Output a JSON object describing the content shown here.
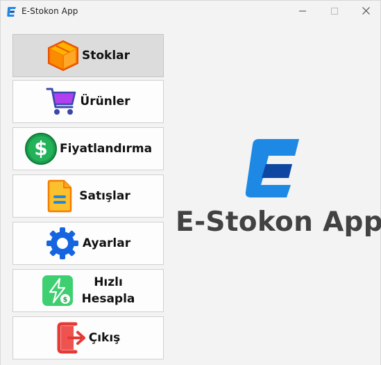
{
  "window": {
    "title": "E-Stokon App",
    "controls": {
      "minimize": "minimize",
      "maximize": "maximize",
      "close": "close"
    }
  },
  "nav": {
    "items": [
      {
        "label": "Stoklar",
        "icon": "box-icon",
        "active": true
      },
      {
        "label": "Ürünler",
        "icon": "cart-icon",
        "active": false
      },
      {
        "label": "Fiyatlandırma",
        "icon": "dollar-icon",
        "active": false
      },
      {
        "label": "Satışlar",
        "icon": "document-icon",
        "active": false
      },
      {
        "label": "Ayarlar",
        "icon": "gear-icon",
        "active": false
      },
      {
        "label_line1": "Hızlı",
        "label_line2": "Hesapla",
        "icon": "quick-calc-icon",
        "active": false
      },
      {
        "label": "Çıkış",
        "icon": "exit-icon",
        "active": false
      }
    ]
  },
  "brand": {
    "name": "E-Stokon App",
    "colors": {
      "logo_light": "#1e88e5",
      "logo_dark": "#0d47a1",
      "text": "#424242"
    }
  }
}
